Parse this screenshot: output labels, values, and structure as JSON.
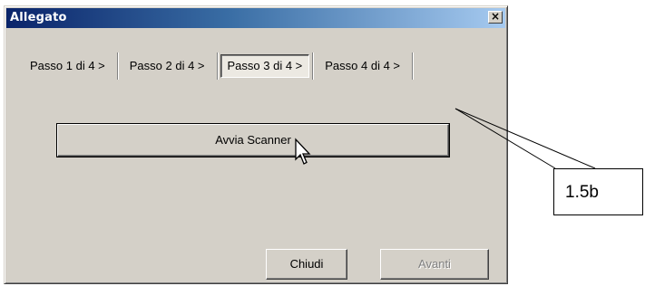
{
  "dialog": {
    "title": "Allegato",
    "close_glyph": "×",
    "close_icon": "close-icon"
  },
  "steps": [
    {
      "label": "Passo 1 di 4 >",
      "active": false
    },
    {
      "label": "Passo 2 di 4 >",
      "active": false
    },
    {
      "label": "Passo 3 di 4 >",
      "active": true
    },
    {
      "label": "Passo 4 di 4 >",
      "active": false
    }
  ],
  "scan_button": {
    "label": "Avvia Scanner"
  },
  "footer": {
    "close_label": "Chiudi",
    "next_label": "Avanti",
    "next_enabled": false
  },
  "cursor_icon": "mouse-pointer-icon",
  "callout": {
    "label": "1.5b"
  },
  "colors": {
    "title_gradient_start": "#0a246a",
    "title_gradient_end": "#a6caf0",
    "face": "#d4d0c8",
    "disabled_text": "#808080"
  }
}
